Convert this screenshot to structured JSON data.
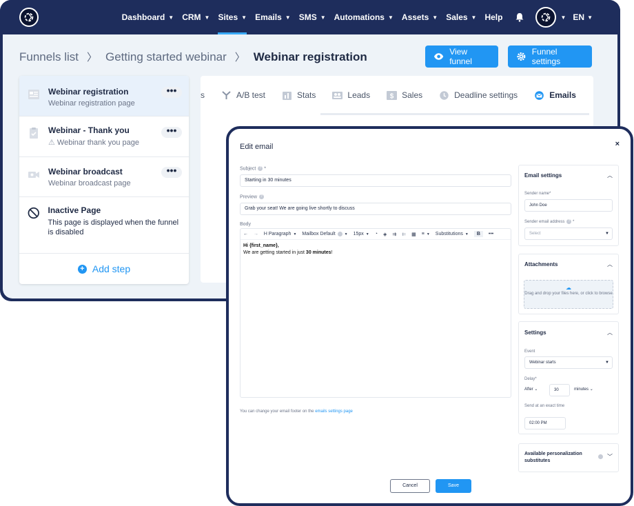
{
  "nav": {
    "items": [
      {
        "label": "Dashboard"
      },
      {
        "label": "CRM"
      },
      {
        "label": "Sites"
      },
      {
        "label": "Emails"
      },
      {
        "label": "SMS"
      },
      {
        "label": "Automations"
      },
      {
        "label": "Assets"
      },
      {
        "label": "Sales"
      },
      {
        "label": "Help"
      }
    ],
    "language": "EN"
  },
  "breadcrumb": {
    "funnels": "Funnels list",
    "webinar": "Getting started webinar",
    "current": "Webinar registration"
  },
  "actions": {
    "view_funnel": "View funnel",
    "funnel_settings": "Funnel settings"
  },
  "steps": [
    {
      "title": "Webinar registration",
      "subtitle": "Webinar registration page",
      "menu": "•••"
    },
    {
      "title": "Webinar - Thank you",
      "subtitle": "Webinar thank you page",
      "menu": "•••"
    },
    {
      "title": "Webinar broadcast",
      "subtitle": "Webinar broadcast page",
      "menu": "•••"
    },
    {
      "title": "Inactive Page",
      "subtitle": "This page is displayed when the funnel is disabled"
    }
  ],
  "add_step": "Add step",
  "tabs": [
    {
      "label": "s"
    },
    {
      "label": "A/B test"
    },
    {
      "label": "Stats"
    },
    {
      "label": "Leads"
    },
    {
      "label": "Sales"
    },
    {
      "label": "Deadline settings"
    },
    {
      "label": "Emails"
    }
  ],
  "modal": {
    "title": "Edit email",
    "close": "×",
    "subject_label": "Subject",
    "subject_value": "Starting in 30 minutes",
    "preview_label": "Preview",
    "preview_value": "Grab your seat! We are going live shortly to discuss",
    "body_label": "Body",
    "toolbar": {
      "paragraph": "Paragraph",
      "font": "Mailbox Default",
      "size": "15px",
      "substitutions": "Substitutions",
      "bold": "B",
      "more": "•••"
    },
    "body_line1": "Hi {first_name},",
    "body_line2_pre": "We are getting started in just ",
    "body_line2_bold": "30 minutes",
    "body_line2_post": "!",
    "footer_note": "You can change your email footer on the ",
    "footer_link": "emails settings page",
    "cancel": "Cancel",
    "save": "Save"
  },
  "sidebar": {
    "email_settings": "Email settings",
    "sender_name_label": "Sender name",
    "sender_name_value": "John Doe",
    "sender_email_label": "Sender email address",
    "sender_email_placeholder": "Select",
    "attachments": "Attachments",
    "drop_text": "Drag and drop your files here, or click to browse",
    "settings": "Settings",
    "event_label": "Event",
    "event_value": "Webinar starts",
    "delay_label": "Delay",
    "delay_before": "After",
    "delay_value": "30",
    "delay_unit": "minutes",
    "exact_time_label": "Send at an exact time",
    "exact_time_value": "02:00 PM",
    "personalization": "Available personalization substitutes"
  },
  "colors": {
    "navy": "#1e2d5c",
    "accent": "#2196f3"
  }
}
